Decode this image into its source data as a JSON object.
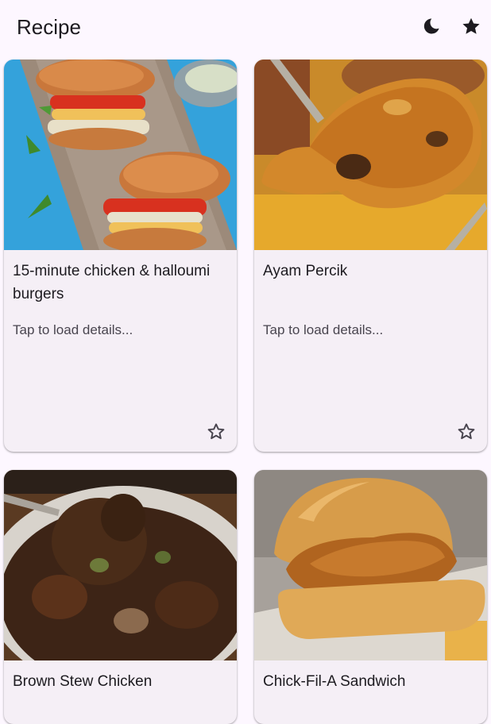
{
  "app_bar": {
    "title": "Recipe",
    "theme_toggle_icon": "moon-icon",
    "favorites_icon": "star-filled-icon"
  },
  "recipes": [
    {
      "title": "15-minute chicken & halloumi burgers",
      "subtitle": "Tap to load details...",
      "favorite_icon": "star-outline-icon",
      "is_favorite": false
    },
    {
      "title": "Ayam Percik",
      "subtitle": "Tap to load details...",
      "favorite_icon": "star-outline-icon",
      "is_favorite": false
    },
    {
      "title": "Brown Stew Chicken"
    },
    {
      "title": "Chick-Fil-A Sandwich"
    }
  ],
  "colors": {
    "background": "#fdf7ff",
    "card": "#f5eff6",
    "text": "#1d1b20",
    "subtext": "#49454f",
    "icon": "#49454f"
  }
}
